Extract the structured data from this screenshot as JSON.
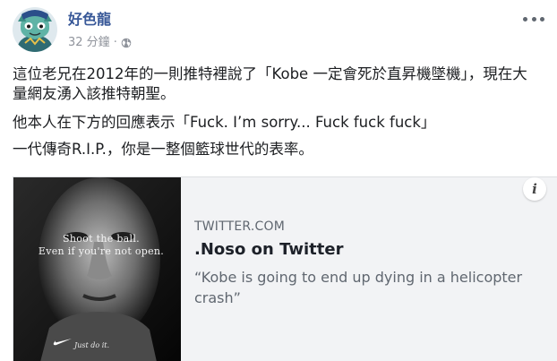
{
  "post": {
    "author": "好色龍",
    "time": "32 分鐘",
    "separator": "·",
    "privacy_icon": "globe-icon",
    "more_icon": "more-options-icon",
    "paragraphs": [
      "這位老兄在2012年的一則推特裡說了「Kobe 一定會死於直昇機墜機」，現在大量網友湧入該推特朝聖。",
      "他本人在下方的回應表示「Fuck. I’m sorry... Fuck fuck fuck」",
      "一代傳奇R.I.P.，你是一整個籃球世代的表率。"
    ]
  },
  "link_card": {
    "image_quote_line1": "Shoot the ball.",
    "image_quote_line2": "Even if you're not open.",
    "image_slogan": "Just do it.",
    "domain": "TWITTER.COM",
    "title": ".Noso on Twitter",
    "description": "“Kobe is going to end up dying in a helicopter crash”",
    "info_label": "i"
  },
  "colors": {
    "author": "#385898",
    "meta": "#90949c",
    "card_bg": "#f2f3f5",
    "card_border": "#dddfe2"
  }
}
